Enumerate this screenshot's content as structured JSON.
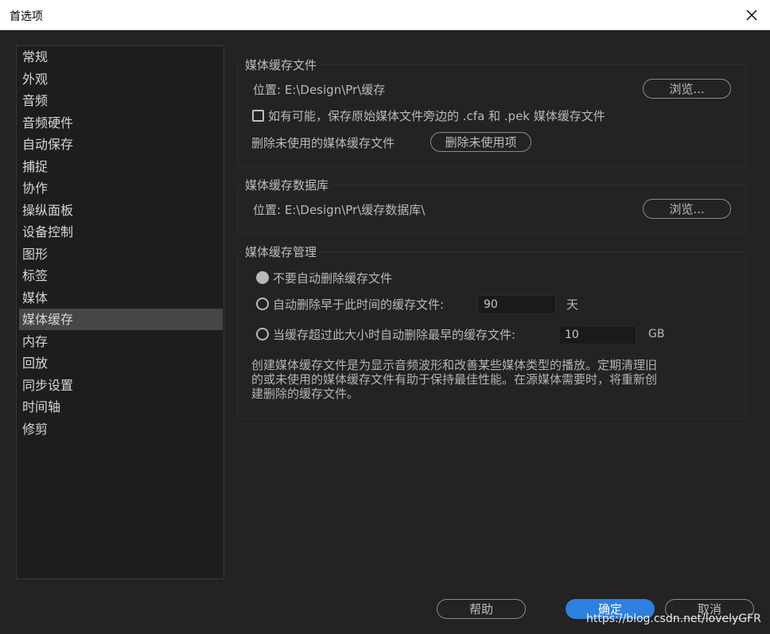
{
  "window": {
    "title": "首选项"
  },
  "sidebar": {
    "items": [
      {
        "label": "常规"
      },
      {
        "label": "外观"
      },
      {
        "label": "音频"
      },
      {
        "label": "音频硬件"
      },
      {
        "label": "自动保存"
      },
      {
        "label": "捕捉"
      },
      {
        "label": "协作"
      },
      {
        "label": "操纵面板"
      },
      {
        "label": "设备控制"
      },
      {
        "label": "图形"
      },
      {
        "label": "标签"
      },
      {
        "label": "媒体"
      },
      {
        "label": "媒体缓存",
        "selected": true
      },
      {
        "label": "内存"
      },
      {
        "label": "回放"
      },
      {
        "label": "同步设置"
      },
      {
        "label": "时间轴"
      },
      {
        "label": "修剪"
      }
    ]
  },
  "cache_files": {
    "title": "媒体缓存文件",
    "location": "位置: E:\\Design\\Pr\\缓存",
    "browse_label": "浏览...",
    "save_beside_label": "如有可能，保存原始媒体文件旁边的 .cfa 和 .pek 媒体缓存文件",
    "save_beside_checked": false,
    "delete_unused_label": "删除未使用的媒体缓存文件",
    "delete_unused_button": "删除未使用项"
  },
  "cache_db": {
    "title": "媒体缓存数据库",
    "location": "位置: E:\\Design\\Pr\\缓存数据库\\",
    "browse_label": "浏览..."
  },
  "cache_mgmt": {
    "title": "媒体缓存管理",
    "option_never": "不要自动删除缓存文件",
    "option_older": "自动删除早于此时间的缓存文件:",
    "older_value": "90",
    "older_unit": "天",
    "option_size": "当缓存超过此大小时自动删除最早的缓存文件:",
    "size_value": "10",
    "size_unit": "GB",
    "description": "创建媒体缓存文件是为显示音频波形和改善某些媒体类型的播放。定期清理旧的或未使用的媒体缓存文件有助于保持最佳性能。在源媒体需要时，将重新创建删除的缓存文件。"
  },
  "footer": {
    "help_label": "帮助",
    "ok_label": "确定",
    "cancel_label": "取消"
  },
  "watermark": "https://blog.csdn.net/lovelyGFR",
  "colors": {
    "accent": "#2d7fe0",
    "background": "#232323",
    "selected_item": "#464646"
  }
}
